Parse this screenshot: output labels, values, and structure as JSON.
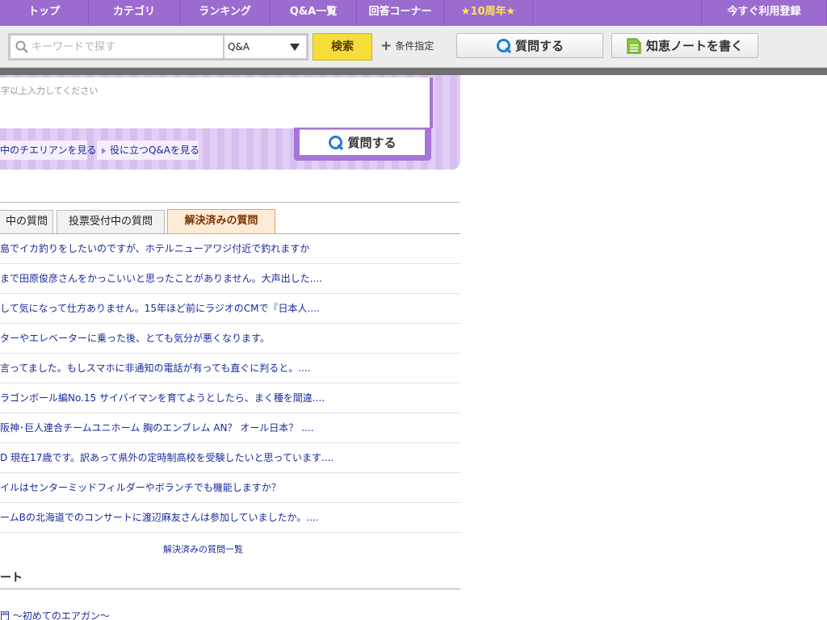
{
  "nav": {
    "items": [
      "トップ",
      "カテゴリ",
      "ランキング",
      "Q&A一覧",
      "回答コーナー",
      "★10周年★"
    ],
    "register": "今すぐ利用登録"
  },
  "search": {
    "placeholder": "キーワードで探す",
    "select_value": "Q&A",
    "button": "検索",
    "condition": "条件指定"
  },
  "actions": {
    "ask": "質問する",
    "note": "知恵ノートを書く"
  },
  "panel": {
    "textarea_placeholder": "文字以上入力してください",
    "ask_button": "質問する",
    "link1": "中のチエリアンを見る",
    "link2": "役に立つQ&Aを見る"
  },
  "tabs": [
    "中の質問",
    "投票受付中の質問",
    "解決済みの質問"
  ],
  "questions": [
    "島でイカ釣りをしたいのですが、ホテルニューアワジ付近で釣れますか",
    "まで田原俊彦さんをかっこいいと思ったことがありません。大声出した....",
    "して気になって仕方ありません。15年ほど前にラジオのCMで『日本人....",
    "ターやエレベーターに乗った後、とても気分が悪くなります。",
    "言ってました。もしスマホに非通知の電話が有っても直ぐに判ると。....",
    "ラゴンボール編No.15 サイバイマンを育てようとしたら、まく種を間違....",
    "阪神･巨人連合チームユニホーム 胸のエンブレム AN？ オール日本？ ....",
    "D 現在17歳です。訳あって県外の定時制高校を受験したいと思っています....",
    "イルはセンターミッドフィルダーやボランチでも機能しますか？",
    "ームBの北海道でのコンサートに渡辺麻友さんは参加していましたか。...."
  ],
  "more_link": "解決済みの質問一覧",
  "section2": {
    "heading": "ート",
    "link": "門 ～初めてのエアガン～"
  },
  "colors": {
    "nav_bg": "#9b6bcf",
    "accent_yellow": "#f7dd3a",
    "link_blue": "#1a2a9a",
    "panel_purple": "#a675d9",
    "tab_active_bg": "#fdebd5"
  }
}
